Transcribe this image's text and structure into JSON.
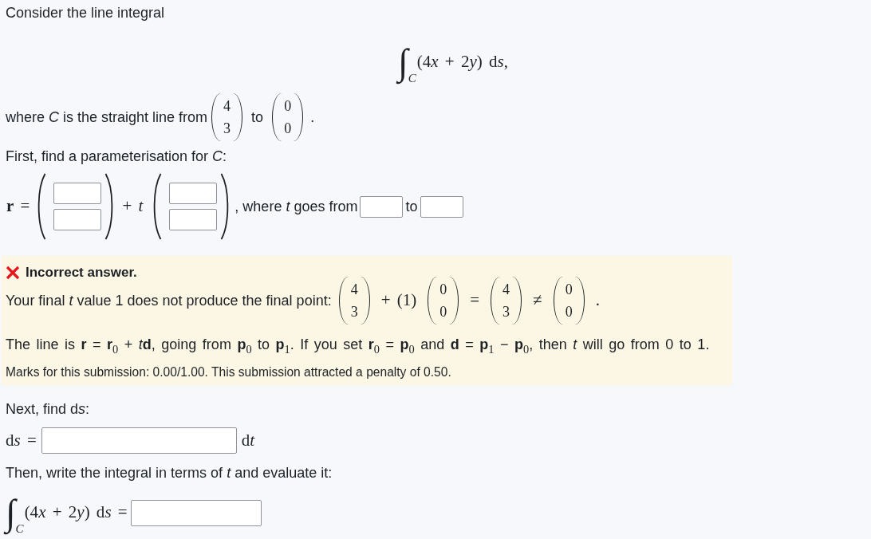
{
  "intro": "Consider the line integral",
  "line_integral": {
    "sign": "∫",
    "domain": "C",
    "integrand": [
      "(4",
      "*x* + 2",
      "*y*) d",
      "*s*,"
    ]
  },
  "curve": {
    "lead": "where *C* is the straight line from",
    "start_point": [
      "4",
      "3"
    ],
    "joiner": "to",
    "end_point": [
      "0",
      "0"
    ],
    "trail": "."
  },
  "parameterisation": {
    "prompt": "First, find a parameterisation for *C*:",
    "lhs": "**r** =",
    "plus_term": "+ *t*",
    "range_text": ", where *t* goes from",
    "range_joiner": "to"
  },
  "feedback": {
    "correct": false,
    "heading": "Incorrect answer.",
    "final_point_text": "Your final *t* value 1 does not produce the final point:",
    "equation": [
      {
        "kind": "vector",
        "entries": [
          "4",
          "3"
        ]
      },
      {
        "kind": "symbol",
        "text": "+ (1)"
      },
      {
        "kind": "vector",
        "entries": [
          "0",
          "0"
        ]
      },
      {
        "kind": "symbol",
        "text": "="
      },
      {
        "kind": "vector",
        "entries": [
          "4",
          "3"
        ]
      },
      {
        "kind": "symbol",
        "text": "≠"
      },
      {
        "kind": "vector",
        "entries": [
          "0",
          "0"
        ]
      },
      {
        "kind": "symbol",
        "text": "."
      }
    ],
    "hint": [
      "The line is **r** = **r**$_{0}$ + *t*",
      "**d**, going from **p**$_{0}$ to **p**$_{1}$. If you set **r**$_{0}$ = **p**$_{0}$ and **d** = **p**$_{1}$ − **p**$_{0}$, then *t* will go from 0 to 1."
    ],
    "marks": "Marks for this submission: 0.00/1.00. This submission attracted a penalty of 0.50."
  },
  "ds_step": {
    "prompt": [
      "Next, find d",
      "*s*:"
    ],
    "lhs": [
      "d",
      "*s* ="
    ],
    "unit": [
      "d",
      "*t*"
    ]
  },
  "evaluate_step": {
    "prompt": "Then, write the integral in terms of *t* and evaluate it:",
    "sign": "∫",
    "domain": "C",
    "integrand": [
      "(4",
      "*x* + 2",
      "*y*) d",
      "*s* ="
    ]
  }
}
